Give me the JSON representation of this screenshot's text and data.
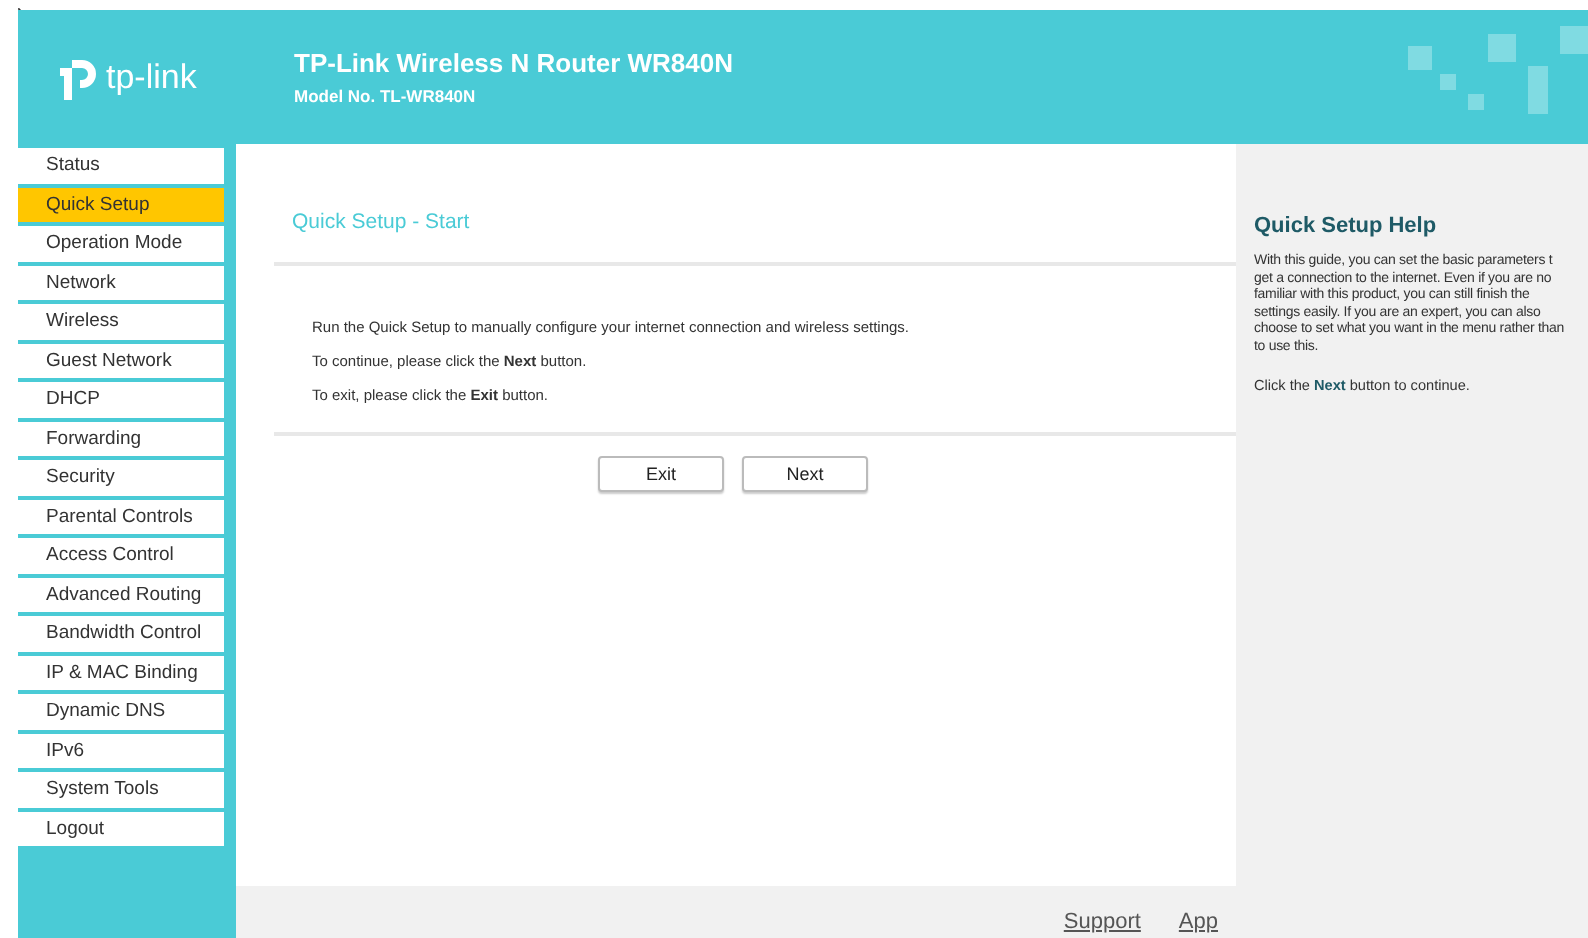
{
  "header": {
    "title": "TP-Link Wireless N Router WR840N",
    "model": "Model No. TL-WR840N",
    "logo_text": "tp-link"
  },
  "sidebar": {
    "items": [
      {
        "label": "Status",
        "selected": false
      },
      {
        "label": "Quick Setup",
        "selected": true
      },
      {
        "label": "Operation Mode",
        "selected": false
      },
      {
        "label": "Network",
        "selected": false
      },
      {
        "label": "Wireless",
        "selected": false
      },
      {
        "label": "Guest Network",
        "selected": false
      },
      {
        "label": "DHCP",
        "selected": false
      },
      {
        "label": "Forwarding",
        "selected": false
      },
      {
        "label": "Security",
        "selected": false
      },
      {
        "label": "Parental Controls",
        "selected": false
      },
      {
        "label": "Access Control",
        "selected": false
      },
      {
        "label": "Advanced Routing",
        "selected": false
      },
      {
        "label": "Bandwidth Control",
        "selected": false
      },
      {
        "label": "IP & MAC Binding",
        "selected": false
      },
      {
        "label": "Dynamic DNS",
        "selected": false
      },
      {
        "label": "IPv6",
        "selected": false
      },
      {
        "label": "System Tools",
        "selected": false
      },
      {
        "label": "Logout",
        "selected": false
      }
    ]
  },
  "main": {
    "title": "Quick Setup - Start",
    "lines": [
      "Run the Quick Setup to manually configure your internet connection and wireless settings.",
      "To continue, please click the **Next** button.",
      "To exit, please click the **Exit** button."
    ],
    "buttons": [
      "Exit",
      "Next"
    ]
  },
  "footer": {
    "links": [
      "Support",
      "App"
    ]
  },
  "help": {
    "title": "Quick Setup Help",
    "lines": [
      "With this guide, you can set the basic parameters t",
      "get a connection to the internet. Even if you are no",
      "familiar with this product, you can still finish the",
      "settings easily. If you are an expert, you can also",
      "choose to set what you want in the menu rather than",
      "to use this."
    ],
    "note": "Click the **Next** button to continue."
  }
}
